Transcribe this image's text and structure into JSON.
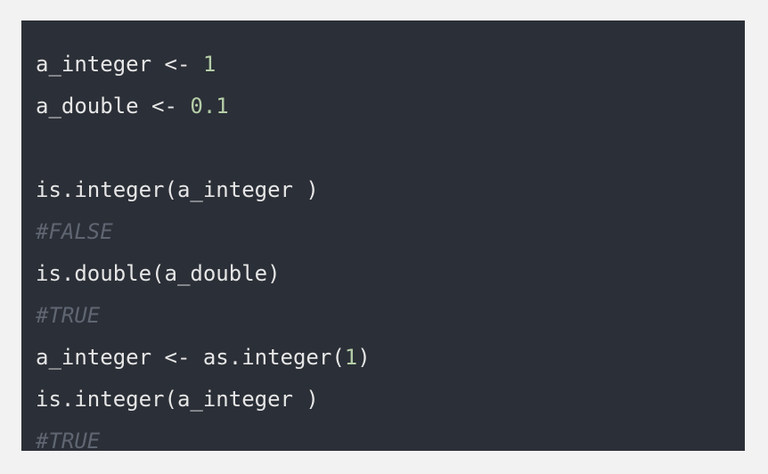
{
  "code": {
    "lines": [
      [
        {
          "t": "a_integer <- ",
          "k": "plain"
        },
        {
          "t": "1",
          "k": "num"
        }
      ],
      [
        {
          "t": "a_double <- ",
          "k": "plain"
        },
        {
          "t": "0.1",
          "k": "num"
        }
      ],
      [],
      [
        {
          "t": "is.integer(a_integer )",
          "k": "plain"
        }
      ],
      [
        {
          "t": "#FALSE",
          "k": "comment"
        }
      ],
      [
        {
          "t": "is.double(a_double)",
          "k": "plain"
        }
      ],
      [
        {
          "t": "#TRUE",
          "k": "comment"
        }
      ],
      [
        {
          "t": "a_integer <- as.integer(",
          "k": "plain"
        },
        {
          "t": "1",
          "k": "num"
        },
        {
          "t": ")",
          "k": "plain"
        }
      ],
      [
        {
          "t": "is.integer(a_integer )",
          "k": "plain"
        }
      ],
      [
        {
          "t": "#TRUE",
          "k": "comment"
        }
      ]
    ]
  },
  "colors": {
    "background": "#2b2f37",
    "text": "#e6e6e6",
    "number": "#b5cea8",
    "comment": "#5f6672"
  }
}
